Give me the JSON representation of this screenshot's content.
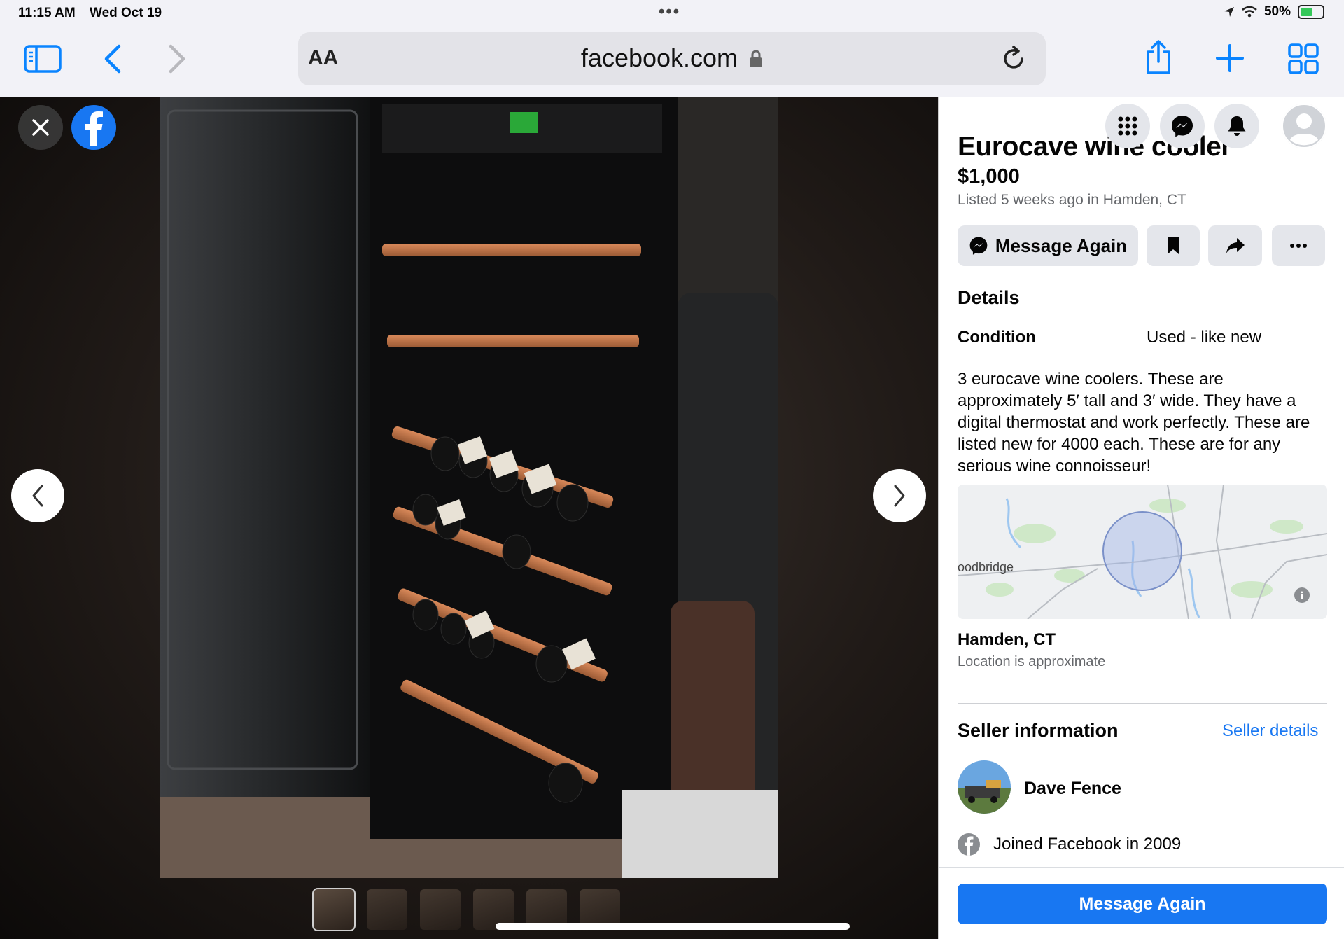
{
  "status_bar": {
    "time": "11:15 AM",
    "date": "Wed Oct 19",
    "battery": "50%"
  },
  "browser": {
    "text_size_label": "AA",
    "url": "facebook.com"
  },
  "icons": {
    "sidebar": "sidebar-icon",
    "back": "chevron-left-icon",
    "forward": "chevron-right-icon",
    "lock": "lock-icon",
    "reload": "reload-icon",
    "share": "share-icon",
    "new_tab": "plus-icon",
    "tabs": "tabs-grid-icon"
  },
  "listing": {
    "title": "Eurocave wine cooler",
    "price": "$1,000",
    "listed": "Listed 5 weeks ago in Hamden, CT",
    "message_again_label": "Message Again",
    "details_heading": "Details",
    "condition_label": "Condition",
    "condition_value": "Used - like new",
    "description": "3 eurocave wine coolers. These are approximately 5′ tall and 3′ wide. They have a digital thermostat and work perfectly. These are listed new for 4000 each. These are for any serious wine connoisseur!",
    "map_place_label": "oodbridge",
    "location_name": "Hamden, CT",
    "location_note": "Location is approximate"
  },
  "seller": {
    "heading": "Seller information",
    "details_link": "Seller details",
    "name": "Dave Fence",
    "joined": "Joined Facebook in 2009"
  },
  "footer": {
    "button_label": "Message Again"
  },
  "photo": {
    "thumbnail_count": 6,
    "active_index": 0
  },
  "colors": {
    "facebook_blue": "#1877f2",
    "safari_blue": "#0a84ff",
    "panel_bg": "#ffffff"
  }
}
